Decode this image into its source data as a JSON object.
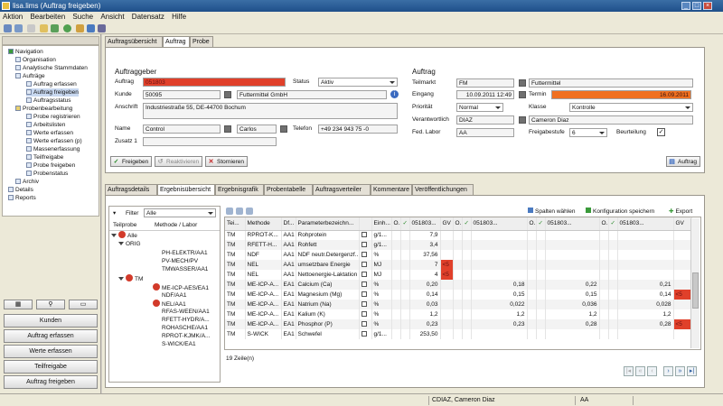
{
  "window": {
    "title": "lisa.lims (Auftrag freigeben)"
  },
  "menu": [
    "Aktion",
    "Bearbeiten",
    "Suche",
    "Ansicht",
    "Datensatz",
    "Hilfe"
  ],
  "nav": {
    "items": [
      {
        "label": "Navigation",
        "level": 0
      },
      {
        "label": "Organisation",
        "level": 1
      },
      {
        "label": "Analytische Stammdaten",
        "level": 1
      },
      {
        "label": "Aufträge",
        "level": 1
      },
      {
        "label": "Auftrag erfassen",
        "level": 2
      },
      {
        "label": "Auftrag freigeben",
        "level": 2,
        "selected": true
      },
      {
        "label": "Auftragsstatus",
        "level": 2
      },
      {
        "label": "Probenbearbeitung",
        "level": 1
      },
      {
        "label": "Probe registrieren",
        "level": 2
      },
      {
        "label": "Arbeitslisten",
        "level": 2
      },
      {
        "label": "Werte erfassen",
        "level": 2
      },
      {
        "label": "Werte erfassen (p)",
        "level": 2
      },
      {
        "label": "Massenerfassung",
        "level": 2
      },
      {
        "label": "Teilfreigabe",
        "level": 2
      },
      {
        "label": "Probe freigeben",
        "level": 2
      },
      {
        "label": "Probenstatus",
        "level": 2
      },
      {
        "label": "Archiv",
        "level": 1
      },
      {
        "label": "Details",
        "level": 0
      },
      {
        "label": "Reports",
        "level": 0
      }
    ],
    "buttons": [
      "Kunden",
      "Auftrag erfassen",
      "Werte erfassen",
      "Teilfreigabe",
      "Auftrag freigeben"
    ]
  },
  "tabs": [
    "Auftragsübersicht",
    "Auftrag",
    "Probe"
  ],
  "auftraggeber": {
    "heading": "Auftraggeber",
    "auftrag_label": "Auftrag",
    "auftrag_value": "051803",
    "status_label": "Status",
    "status_value": "Aktiv",
    "kunde_label": "Kunde",
    "kunde_value": "50095",
    "kunde_name": "Futtermittel GmbH",
    "anschrift_label": "Anschrift",
    "anschrift_value": "Industriestraße 55, DE-44700 Bochum",
    "name_label": "Name",
    "name_value": "Control",
    "name_value2": "Carlos",
    "telefon_label": "Telefon",
    "telefon_value": "+49 234 943 75 -0",
    "zusatz_label": "Zusatz 1"
  },
  "auftrag": {
    "heading": "Auftrag",
    "teilmarkt_label": "Teilmarkt",
    "teilmarkt_value": "FM",
    "teilmarkt_name": "Futtermittel",
    "eingang_label": "Eingang",
    "eingang_value": "10.09.2011 12:49",
    "termin_label": "Termin",
    "termin_value": "16.09.2011",
    "prioritaet_label": "Priorität",
    "prioritaet_value": "Normal",
    "klasse_label": "Klasse",
    "klasse_value": "Kontrolle",
    "verantwortlich_label": "Verantwortlich",
    "verantwortlich_value": "DIAZ",
    "verantwortlich_name": "Cameron Diaz",
    "fedlabor_label": "Fed. Labor",
    "fedlabor_value": "AA",
    "freigabestufe_label": "Freigabestufe",
    "freigabestufe_value": "6",
    "beurteilung_label": "Beurteilung"
  },
  "actions": {
    "freigeben": "Freigeben",
    "reaktivieren": "Reaktivieren",
    "stornieren": "Stornieren",
    "auftrag": "Auftrag"
  },
  "subtabs": [
    "Auftragsdetails",
    "Ergebnisübersicht",
    "Ergebnisgrafik",
    "Probentabelle",
    "Auftragsverteiler",
    "Kommentare",
    "Veröffentlichungen"
  ],
  "filter": {
    "label": "Filter",
    "value": "Alle",
    "col1": "Teilprobe",
    "col2": "Methode / Labor"
  },
  "ftree": [
    {
      "label": "Alle",
      "level": 0
    },
    {
      "label": "ORIG",
      "level": 1
    },
    {
      "label": "PH-ELEKTR/AA1",
      "level": 2
    },
    {
      "label": "PV-MECH/PV",
      "level": 2
    },
    {
      "label": "TMWASSER/AA1",
      "level": 2
    },
    {
      "label": "TM",
      "level": 1
    },
    {
      "label": "ME-ICP-AES/EA1",
      "level": 2
    },
    {
      "label": "NDF/AA1",
      "level": 2
    },
    {
      "label": "NEL/AA1",
      "level": 2
    },
    {
      "label": "RFAS-WEEN/AA1",
      "level": 2
    },
    {
      "label": "RFETT-HYDR/A...",
      "level": 2
    },
    {
      "label": "ROHASCHE/AA1",
      "level": 2
    },
    {
      "label": "RPROT-KJMK/A...",
      "level": 2
    },
    {
      "label": "S-WICK/EA1",
      "level": 2
    }
  ],
  "grid_toolbar": {
    "spalten": "Spalten wählen",
    "konfig": "Konfiguration speichern",
    "export": "Export"
  },
  "grid": {
    "headers": [
      "Tei...",
      "Methode",
      "Df...",
      "Parameterbezeichn...",
      "",
      "Einh...",
      "O.",
      "",
      "051803...",
      "GV",
      "O.",
      "",
      "051803...",
      "O.",
      "",
      "051803...",
      "O.",
      "",
      "051803...",
      "GV"
    ],
    "rows": [
      [
        "TM",
        "RPROT-K...",
        "AA1",
        "Rohprotein",
        "g/1...",
        "7,9",
        "",
        "",
        "",
        "",
        ""
      ],
      [
        "TM",
        "RFETT-H...",
        "AA1",
        "Rohfett",
        "g/1...",
        "3,4",
        "",
        "",
        "",
        "",
        ""
      ],
      [
        "TM",
        "NDF",
        "AA1",
        "NDF neutr.Detergenzf...",
        "%",
        "37,56",
        "",
        "",
        "",
        "",
        ""
      ],
      [
        "TM",
        "NEL",
        "AA1",
        "umsetzbare Energie",
        "MJ",
        "7",
        "<5",
        "",
        "",
        "",
        ""
      ],
      [
        "TM",
        "NEL",
        "AA1",
        "Nettoenergie-Laktation",
        "MJ",
        "4",
        "<5",
        "",
        "",
        "",
        ""
      ],
      [
        "TM",
        "ME-ICP-A...",
        "EA1",
        "Calcium (Ca)",
        "%",
        "0,20",
        "",
        "0,18",
        "0,22",
        "0,21",
        ""
      ],
      [
        "TM",
        "ME-ICP-A...",
        "EA1",
        "Magnesium (Mg)",
        "%",
        "0,14",
        "",
        "0,15",
        "0,15",
        "0,14",
        "<5"
      ],
      [
        "TM",
        "ME-ICP-A...",
        "EA1",
        "Natrium (Na)",
        "%",
        "0,03",
        "",
        "0,022",
        "0,036",
        "0,028",
        ""
      ],
      [
        "TM",
        "ME-ICP-A...",
        "EA1",
        "Kalium (K)",
        "%",
        "1,2",
        "",
        "1,2",
        "1,2",
        "1,2",
        ""
      ],
      [
        "TM",
        "ME-ICP-A...",
        "EA1",
        "Phosphor (P)",
        "%",
        "0,23",
        "",
        "0,23",
        "0,28",
        "0,28",
        "<5"
      ],
      [
        "TM",
        "S-WICK",
        "EA1",
        "Schwefel",
        "g/1...",
        "253,50",
        "",
        "",
        "",
        "",
        ""
      ]
    ],
    "rowcount": "19 Zeile(n)"
  },
  "status": {
    "user": "CDIAZ, Cameron Diaz",
    "labor": "AA"
  }
}
